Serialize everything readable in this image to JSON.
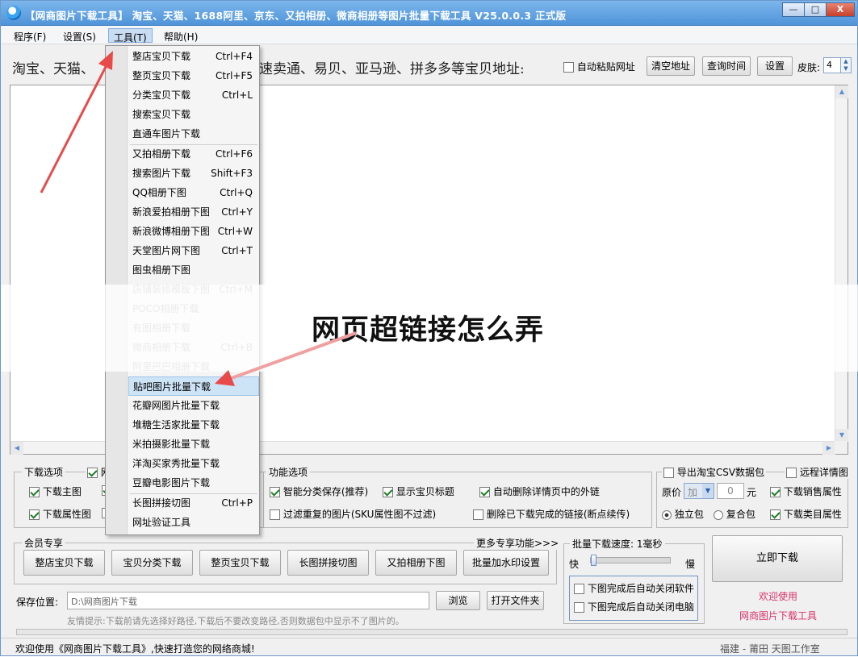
{
  "window": {
    "title": "【网商图片下载工具】 淘宝、天猫、1688阿里、京东、又拍相册、微商相册等图片批量下载工具 V25.0.0.3 正式版",
    "controls": {
      "minimize": "—",
      "maximize": "□",
      "close": "X"
    }
  },
  "menu": [
    "程序(F)",
    "设置(S)",
    "工具(T)",
    "帮助(H)"
  ],
  "url_row": {
    "label_left": "淘宝、天猫、",
    "label_right": "速卖通、易贝、亚马逊、拼多多等宝贝地址:",
    "auto_paste": "自动粘贴网址",
    "clear_btn": "清空地址",
    "query_btn": "查询时间",
    "settings_btn": "设置",
    "skin_label": "皮肤:",
    "skin_value": "4"
  },
  "tools_menu": [
    {
      "label": "整店宝贝下载",
      "shortcut": "Ctrl+F4",
      "disabled": false
    },
    {
      "label": "整页宝贝下载",
      "shortcut": "Ctrl+F5",
      "disabled": false
    },
    {
      "label": "分类宝贝下载",
      "shortcut": "Ctrl+L",
      "disabled": false
    },
    {
      "label": "搜索宝贝下载",
      "shortcut": "",
      "disabled": false
    },
    {
      "label": "直通车图片下载",
      "shortcut": "",
      "disabled": false
    },
    {
      "label": "又拍相册下载",
      "shortcut": "Ctrl+F6",
      "disabled": false
    },
    {
      "label": "搜索图片下载",
      "shortcut": "Shift+F3",
      "disabled": false
    },
    {
      "label": "QQ相册下图",
      "shortcut": "Ctrl+Q",
      "disabled": false
    },
    {
      "label": "新浪爱拍相册下图",
      "shortcut": "Ctrl+Y",
      "disabled": false
    },
    {
      "label": "新浪微博相册下图",
      "shortcut": "Ctrl+W",
      "disabled": false
    },
    {
      "label": "天堂图片网下图",
      "shortcut": "Ctrl+T",
      "disabled": false
    },
    {
      "label": "图虫相册下图",
      "shortcut": "",
      "disabled": false
    },
    {
      "label": "店铺装修模板下图",
      "shortcut": "Ctrl+M",
      "disabled": true
    },
    {
      "label": "POCO相册下载",
      "shortcut": "",
      "disabled": true
    },
    {
      "label": "有图相册下载",
      "shortcut": "",
      "disabled": true
    },
    {
      "label": "微商相册下载",
      "shortcut": "Ctrl+B",
      "disabled": true
    },
    {
      "label": "阿里巴巴相册下载",
      "shortcut": "",
      "disabled": true
    },
    {
      "label": "贴吧图片批量下载",
      "shortcut": "",
      "disabled": false
    },
    {
      "label": "花瓣网图片批量下载",
      "shortcut": "",
      "disabled": false
    },
    {
      "label": "堆糖生活家批量下载",
      "shortcut": "",
      "disabled": false
    },
    {
      "label": "米拍摄影批量下载",
      "shortcut": "",
      "disabled": false
    },
    {
      "label": "洋淘买家秀批量下载",
      "shortcut": "",
      "disabled": false
    },
    {
      "label": "豆瓣电影图片下载",
      "shortcut": "",
      "disabled": false
    },
    {
      "label": "长图拼接切图",
      "shortcut": "Ctrl+P",
      "disabled": false
    },
    {
      "label": "网址验证工具",
      "shortcut": "",
      "disabled": false
    }
  ],
  "overlay_text": "网页超链接怎么弄",
  "download_options": {
    "title": "下载选项",
    "title_suffix": "网",
    "main_image": "下载主图",
    "attr_image": "下载属性图"
  },
  "function_options": {
    "title": "功能选项",
    "smart_save": "智能分类保存(推荐)",
    "show_title": "显示宝贝标题",
    "auto_delete_links": "自动删除详情页中的外链",
    "filter_dup": "过滤重复的图片(SKU属性图不过滤)",
    "delete_done": "删除已下载完成的链接(断点续传)"
  },
  "csv_options": {
    "export_csv": "导出淘宝CSV数据包",
    "remote_detail": "远程详情图",
    "price_label": "原价",
    "op_value": "加",
    "amount": "0",
    "unit": "元",
    "download_sales_attr": "下载销售属性",
    "standalone": "独立包",
    "combined": "复合包",
    "download_category_attr": "下载类目属性"
  },
  "member": {
    "title": "会员专享",
    "more": "更多专享功能>>>",
    "buttons": [
      "整店宝贝下载",
      "宝贝分类下载",
      "整页宝贝下载",
      "长图拼接切图",
      "又拍相册下图",
      "批量加水印设置"
    ]
  },
  "speed": {
    "title": "批量下载速度: 1毫秒",
    "fast": "快",
    "slow": "慢",
    "value_ms": 1,
    "close_app": "下图完成后自动关闭软件",
    "close_pc": "下图完成后自动关闭电脑"
  },
  "download_now": "立即下载",
  "welcome": {
    "line1": "欢迎使用",
    "line2": "网商图片下载工具"
  },
  "save": {
    "label": "保存位置:",
    "path": "D:\\网商图片下载",
    "browse": "浏览",
    "open_folder": "打开文件夹",
    "tip": "友情提示:下载前请先选择好路径,下载后不要改变路径,否则数据包中显示不了图片的。"
  },
  "status": {
    "left": "欢迎使用《网商图片下载工具》,快速打造您的网络商城!",
    "right": "福建 - 莆田  天图工作室"
  },
  "colors": {
    "title_bar": "#5a9de0",
    "welcome_text": "#d6336c",
    "arrow": "#e84a4a"
  }
}
